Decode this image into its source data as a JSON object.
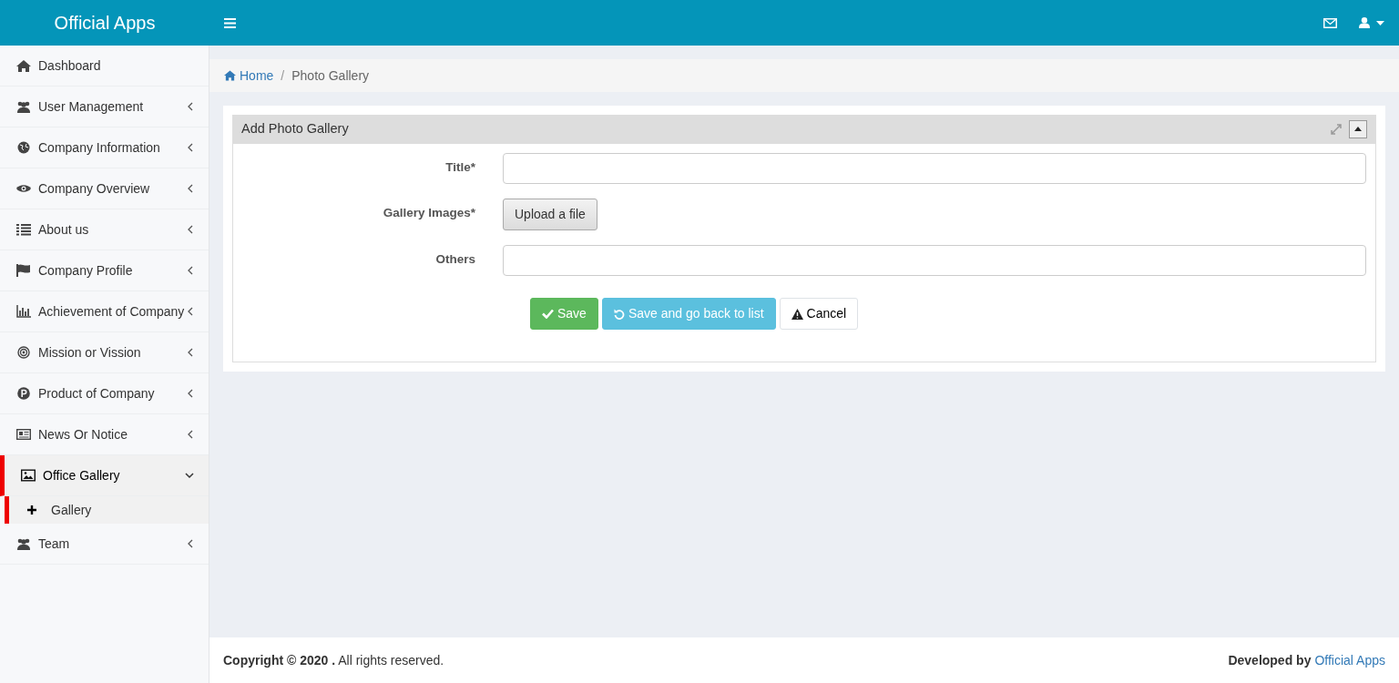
{
  "brand": "Official Apps",
  "sidebar": {
    "items": [
      {
        "label": "Dashboard",
        "has_submenu": false,
        "selected": false
      },
      {
        "label": "User Management",
        "has_submenu": true,
        "expanded": false,
        "selected": false
      },
      {
        "label": "Company Information",
        "has_submenu": true,
        "expanded": false,
        "selected": false
      },
      {
        "label": "Company Overview",
        "has_submenu": true,
        "expanded": false,
        "selected": false
      },
      {
        "label": "About us",
        "has_submenu": true,
        "expanded": false,
        "selected": false
      },
      {
        "label": "Company Profile",
        "has_submenu": true,
        "expanded": false,
        "selected": false
      },
      {
        "label": "Achievement of Company",
        "has_submenu": true,
        "expanded": false,
        "selected": false
      },
      {
        "label": "Mission or Vission",
        "has_submenu": true,
        "expanded": false,
        "selected": false
      },
      {
        "label": "Product of Company",
        "has_submenu": true,
        "expanded": false,
        "selected": false
      },
      {
        "label": "News Or Notice",
        "has_submenu": true,
        "expanded": false,
        "selected": false
      },
      {
        "label": "Office Gallery",
        "has_submenu": true,
        "expanded": true,
        "selected": true,
        "children": [
          {
            "label": "Gallery",
            "selected": true
          }
        ]
      },
      {
        "label": "Team",
        "has_submenu": true,
        "expanded": false,
        "selected": false
      }
    ]
  },
  "breadcrumb": [
    {
      "label": "Home"
    },
    {
      "label": "Photo Gallery"
    }
  ],
  "breadcrumb_separator": "/",
  "panel": {
    "title": "Add Photo Gallery",
    "fields": [
      {
        "kind": "text",
        "label": "Title*"
      },
      {
        "kind": "upload",
        "label": "Gallery Images*",
        "button": "Upload a file"
      },
      {
        "kind": "text",
        "label": "Others"
      }
    ],
    "buttons": [
      {
        "kind": "save",
        "label": "Save"
      },
      {
        "kind": "back",
        "label": "Save and go back to list"
      },
      {
        "kind": "cancel",
        "label": "Cancel"
      }
    ]
  },
  "footer": {
    "copyright": "**Copyright © 2020 .** All rights reserved.",
    "developed_by": "Developed by",
    "developer": "Official Apps"
  }
}
